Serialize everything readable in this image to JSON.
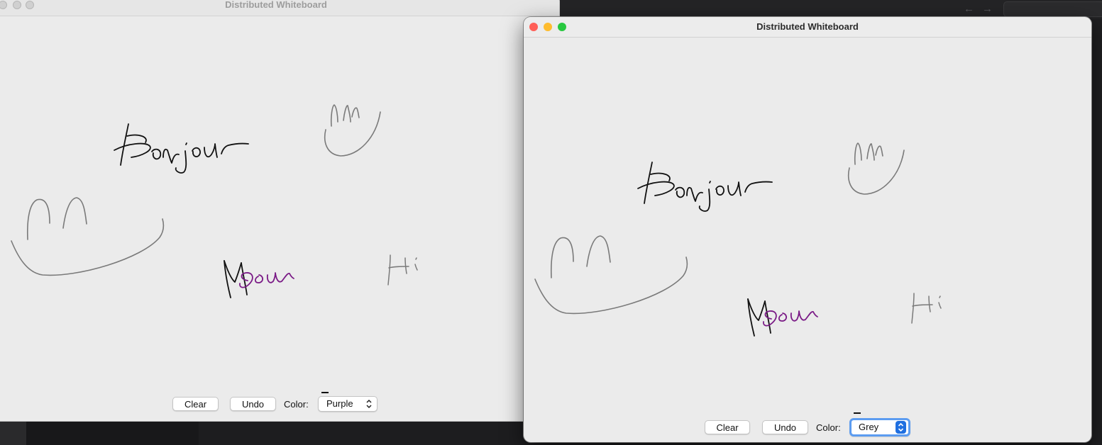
{
  "background": {
    "nav_back": "←",
    "nav_forward": "→"
  },
  "windows": [
    {
      "id": "left",
      "title": "Distributed Whiteboard",
      "toolbar": {
        "clear_label": "Clear",
        "undo_label": "Undo",
        "color_label": "Color:",
        "color_selected": "Purple",
        "color_focused": false
      }
    },
    {
      "id": "right",
      "title": "Distributed Whiteboard",
      "toolbar": {
        "clear_label": "Clear",
        "undo_label": "Undo",
        "color_label": "Color:",
        "color_selected": "Grey",
        "color_focused": true
      }
    }
  ],
  "drawing": {
    "texts": [
      "Bonjour",
      "Meow",
      "Hi"
    ],
    "stroke_colors": {
      "black": "#111111",
      "grey": "#7a7a7a",
      "purple": "#7a1a86"
    }
  },
  "traffic_lights": {
    "close": "#ff5f57",
    "minimize": "#febc2e",
    "zoom": "#28c840"
  }
}
